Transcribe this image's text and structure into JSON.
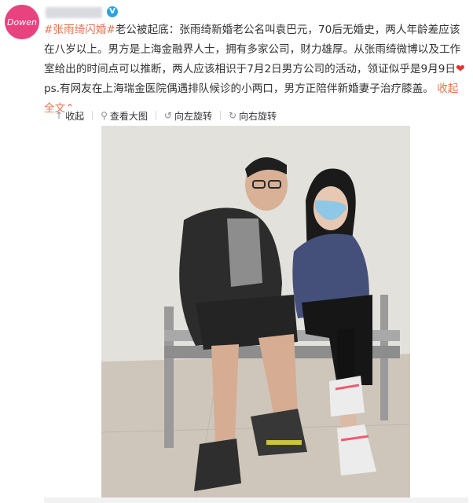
{
  "post": {
    "avatar_text": "Dowen",
    "verified_badge": "V",
    "tags": [
      "#张雨绮",
      "闪婚#"
    ],
    "text_part1": "老公被起底：张雨绮新婚老公名叫袁巴元，70后无婚史，两人年龄差应该在八岁以上。男方是上海金融界人士，拥有多家公司，财力雄厚。从张雨绮微博以及工作室给出的时间点可以推断，两人应该相识于7月2日男方公司的活动，领证似乎是9月9日",
    "text_part2": "ps.有网友在上海瑞金医院偶遇排队候诊的小两口，男方正陪伴新婚妻子治疗膝盖。",
    "collapse_label": "收起全文",
    "collapse_icon": "chevron-up"
  },
  "toolbar": {
    "items": [
      {
        "icon": "arrow-up",
        "label": "收起"
      },
      {
        "icon": "search",
        "label": "查看大图"
      },
      {
        "icon": "rotate-left",
        "label": "向左旋转"
      },
      {
        "icon": "rotate-right",
        "label": "向右旋转"
      }
    ]
  },
  "colors": {
    "tag": "#eb7350",
    "avatar": "#e8437f",
    "verified": "#2ba3e3",
    "heart": "#e6302c"
  }
}
